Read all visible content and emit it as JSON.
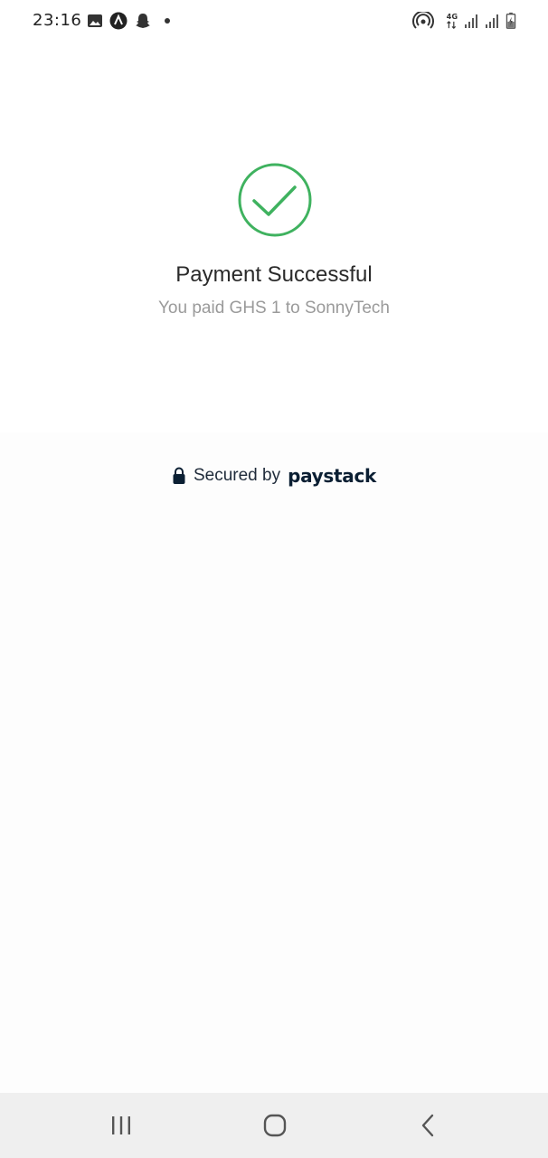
{
  "status_bar": {
    "time": "23:16",
    "icons": [
      "gallery-icon",
      "app-a-icon",
      "snapchat-icon",
      "notification-dot-icon",
      "hotspot-icon",
      "network-4g-icon",
      "signal-1-icon",
      "signal-2-icon",
      "battery-icon"
    ],
    "network_label": "4G"
  },
  "success": {
    "icon": "check-circle-icon",
    "title": "Payment Successful",
    "subtitle": "You paid GHS 1 to SonnyTech",
    "accent_color": "#3fb25f"
  },
  "footer": {
    "lock_icon": "lock-icon",
    "secured_label": "Secured by",
    "brand": "paystack",
    "brand_color": "#0b1f33"
  },
  "nav": {
    "buttons": [
      "recent-apps",
      "home",
      "back"
    ]
  }
}
